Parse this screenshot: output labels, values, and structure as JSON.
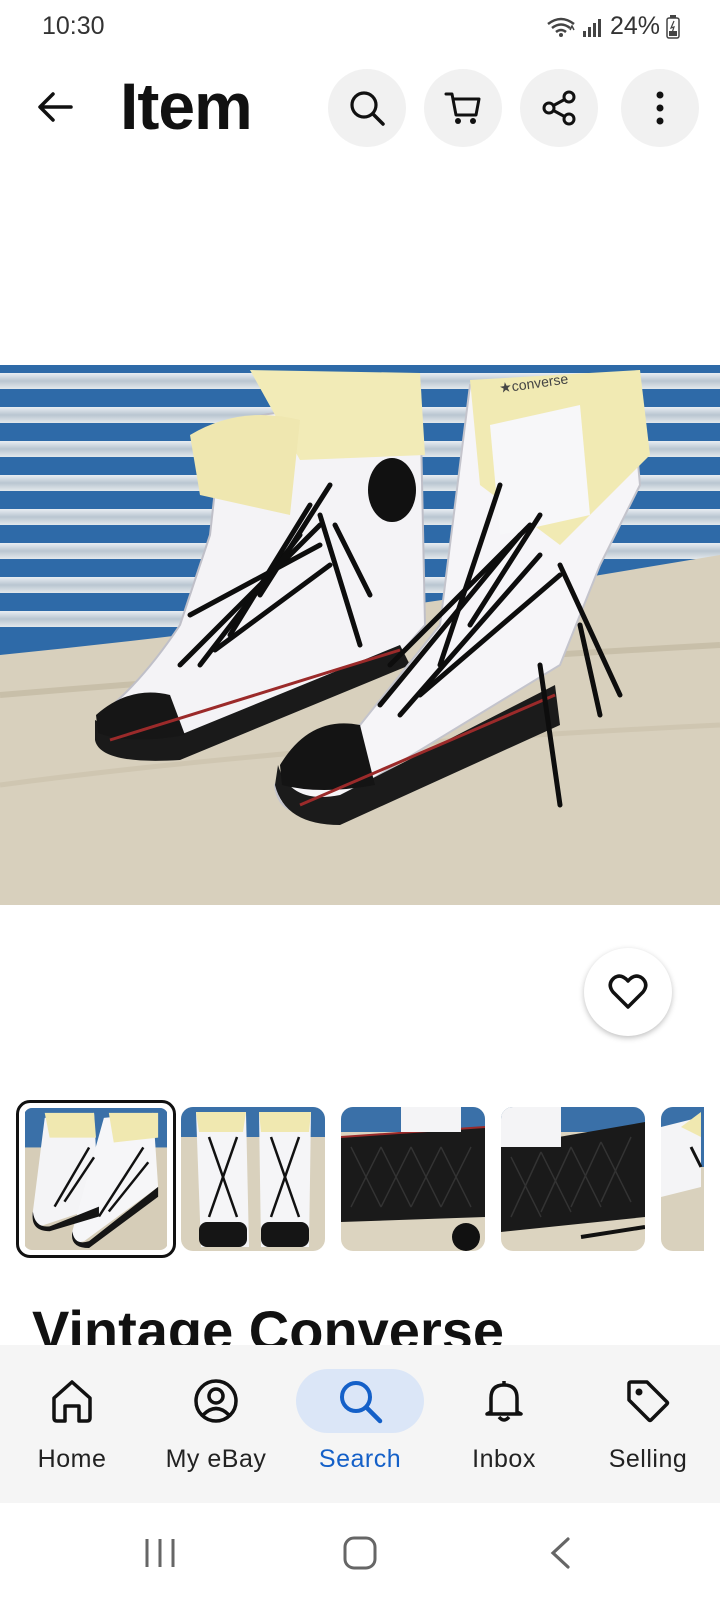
{
  "status_bar": {
    "time": "10:30",
    "battery": "24%",
    "icons": [
      "wifi-icon",
      "signal-icon",
      "battery-icon"
    ]
  },
  "header": {
    "title": "Item",
    "back_icon": "arrow-left-icon",
    "actions": [
      "search-icon",
      "cart-icon",
      "share-icon",
      "more-vertical-icon"
    ]
  },
  "gallery": {
    "main_image_alt": "Pair of white high-top sneakers with black laces",
    "favorite_icon": "heart-icon",
    "thumbnails_selected_index": 0,
    "thumbnail_count_visible": 5
  },
  "item": {
    "title": "Vintage Converse"
  },
  "bottom_nav": {
    "items": [
      {
        "label": "Home",
        "icon": "home-icon"
      },
      {
        "label": "My eBay",
        "icon": "account-icon"
      },
      {
        "label": "Search",
        "icon": "search-icon",
        "active": true
      },
      {
        "label": "Inbox",
        "icon": "bell-icon"
      },
      {
        "label": "Selling",
        "icon": "tag-icon"
      }
    ]
  },
  "system_nav": [
    "recents-icon",
    "home-icon",
    "back-icon"
  ],
  "colors": {
    "accent": "#1460c8",
    "active_nav_bg": "#dbe6f7",
    "header_button_bg": "#f1f1f1"
  }
}
